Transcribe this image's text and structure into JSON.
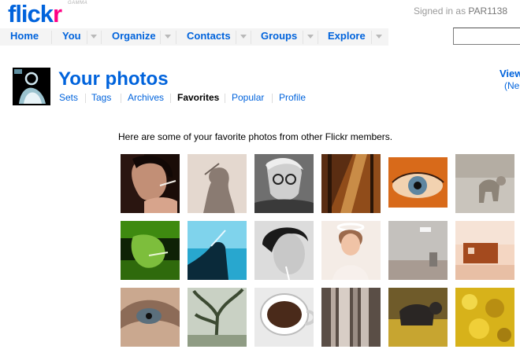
{
  "brand": {
    "logo": "flickr",
    "logo_r": "r",
    "gamma": "GAMMA"
  },
  "header": {
    "signed_in_prefix": "Signed in as",
    "username": "PAR1138"
  },
  "nav": {
    "items": [
      "Home",
      "You",
      "Organize",
      "Contacts",
      "Groups",
      "Explore"
    ],
    "search_value": ""
  },
  "page": {
    "title": "Your photos",
    "subnav": [
      "Sets",
      "Tags",
      "Archives",
      "Favorites",
      "Popular",
      "Profile"
    ],
    "active_subnav": "Favorites",
    "view_link": "View",
    "new_link": "(Ne",
    "intro": "Here are some of your favorite photos from other Flickr members."
  },
  "favorites": [
    {
      "icon": "portrait-smoking-photo"
    },
    {
      "icon": "shadow-photo"
    },
    {
      "icon": "man-with-glasses-photo"
    },
    {
      "icon": "sunlit-forest-photo"
    },
    {
      "icon": "eye-closeup-photo"
    },
    {
      "icon": "cat-walking-photo"
    },
    {
      "icon": "green-smoker-photo"
    },
    {
      "icon": "silhouette-smoking-photo"
    },
    {
      "icon": "woman-smoking-bw-photo"
    },
    {
      "icon": "angel-girl-photo"
    },
    {
      "icon": "wall-doorway-photo"
    },
    {
      "icon": "trailer-house-photo"
    },
    {
      "icon": "eye-tear-photo"
    },
    {
      "icon": "misty-tree-photo"
    },
    {
      "icon": "coffee-cup-photo"
    },
    {
      "icon": "curtain-window-photo"
    },
    {
      "icon": "cat-in-leaves-photo"
    },
    {
      "icon": "yellow-leaves-photo"
    },
    {
      "icon": "night-mountain-photo"
    }
  ],
  "colors": {
    "brand_blue": "#0063dc",
    "brand_pink": "#ff0084"
  }
}
